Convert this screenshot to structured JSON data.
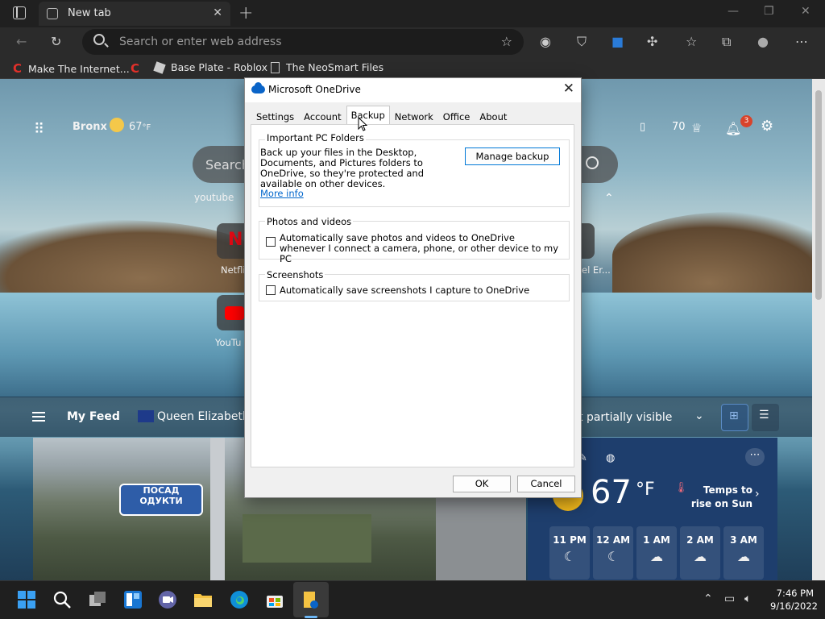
{
  "browser": {
    "tab_title": "New tab",
    "address_placeholder": "Search or enter web address",
    "bookmarks": [
      "Make The Internet...",
      "Base Plate - Roblox",
      "The NeoSmart Files"
    ]
  },
  "newtab": {
    "location": "Bronx",
    "temperature": "67",
    "temp_unit": "°F",
    "search_placeholder": "Search",
    "quick_link": "youtube",
    "tiles": [
      "Netfli",
      "YouTu",
      "el Er..."
    ],
    "rewards_points": "70",
    "notification_count": "3",
    "feed": {
      "title": "My Feed",
      "topic": "Queen Elizabeth I",
      "visibility": "t partially visible"
    },
    "news_sign": [
      "ПОСАД",
      "ОДУКТИ"
    ],
    "weather": {
      "temp": "67",
      "unit": "°F",
      "note": "Temps to rise on Sun",
      "hours": [
        {
          "time": "11 PM"
        },
        {
          "time": "12 AM"
        },
        {
          "time": "1 AM"
        },
        {
          "time": "2 AM"
        },
        {
          "time": "3 AM"
        }
      ]
    }
  },
  "dialog": {
    "title": "Microsoft OneDrive",
    "tabs": [
      "Settings",
      "Account",
      "Backup",
      "Network",
      "Office",
      "About"
    ],
    "active_tab": "Backup",
    "important_folders": {
      "title": "Important PC Folders",
      "description": "Back up your files in the Desktop, Documents, and Pictures folders to OneDrive, so they're protected and available on other devices.",
      "manage_button": "Manage backup",
      "more_info": "More info"
    },
    "photos": {
      "title": "Photos and videos",
      "checkbox_label": "Automatically save photos and videos to OneDrive whenever I connect a camera, phone, or other device to my PC",
      "checked": false
    },
    "screenshots": {
      "title": "Screenshots",
      "checkbox_label": "Automatically save screenshots I capture to OneDrive",
      "checked": false
    },
    "ok_button": "OK",
    "cancel_button": "Cancel"
  },
  "taskbar": {
    "time": "7:46 PM",
    "date": "9/16/2022"
  },
  "colors": {
    "accent": "#0078d7",
    "link": "#0066cc",
    "badge": "#d8432b"
  }
}
